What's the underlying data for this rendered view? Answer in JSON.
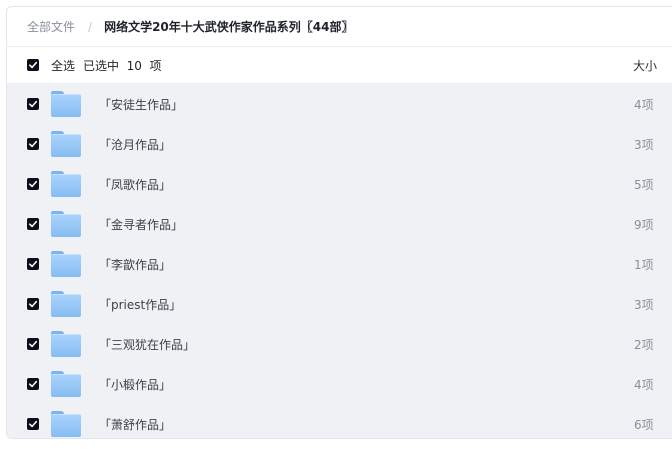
{
  "breadcrumb": {
    "root": "全部文件",
    "separator": "/",
    "current": "网络文学20年十大武侠作家作品系列〖44部〗"
  },
  "header": {
    "select_all": "全选",
    "selected_count": "已选中  10  项",
    "size_column": "大小"
  },
  "rows": [
    {
      "name": "「安徒生作品」",
      "size": "4项",
      "checked": true,
      "icon": "folder-icon"
    },
    {
      "name": "「沧月作品」",
      "size": "3项",
      "checked": true,
      "icon": "folder-icon"
    },
    {
      "name": "「凤歌作品」",
      "size": "5项",
      "checked": true,
      "icon": "folder-icon"
    },
    {
      "name": "「金寻者作品」",
      "size": "9项",
      "checked": true,
      "icon": "folder-icon"
    },
    {
      "name": "「李歆作品」",
      "size": "1项",
      "checked": true,
      "icon": "folder-icon"
    },
    {
      "name": "「priest作品」",
      "size": "3项",
      "checked": true,
      "icon": "folder-icon"
    },
    {
      "name": "「三观犹在作品」",
      "size": "2项",
      "checked": true,
      "icon": "folder-icon"
    },
    {
      "name": "「小椴作品」",
      "size": "4项",
      "checked": true,
      "icon": "folder-icon"
    },
    {
      "name": "「萧舒作品」",
      "size": "6项",
      "checked": true,
      "icon": "folder-icon"
    }
  ],
  "colors": {
    "selected_row_bg": "#f0f1f4",
    "checkbox": "#0b0f1a",
    "folder": "#85bdf2"
  }
}
